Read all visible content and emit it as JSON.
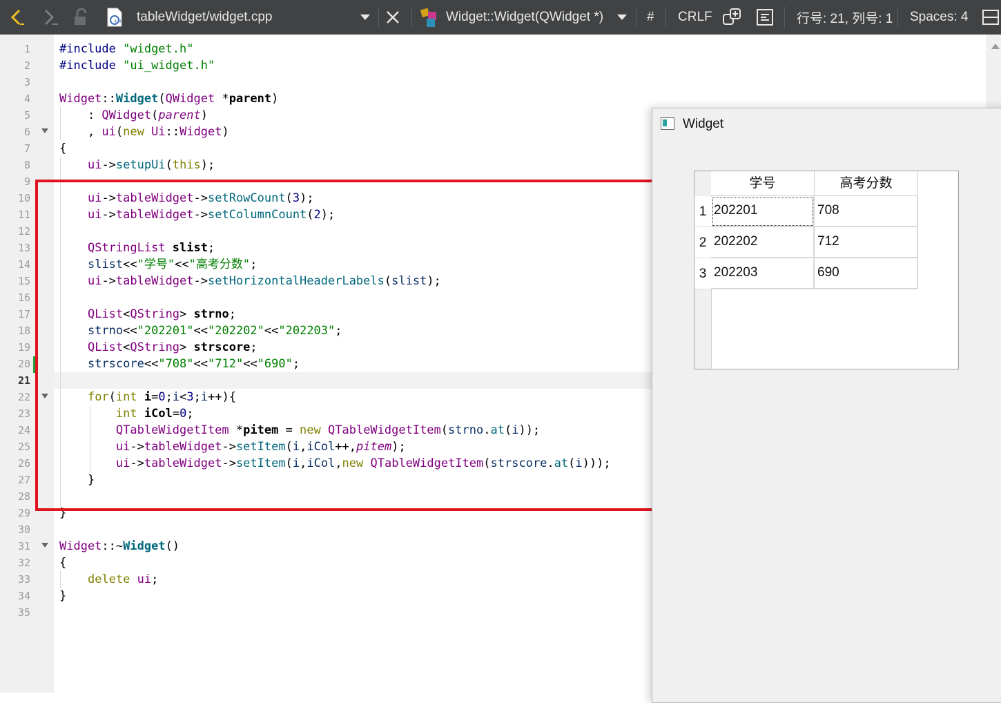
{
  "toolbar": {
    "file_name": "tableWidget/widget.cpp",
    "symbol": "Widget::Widget(QWidget *)",
    "hash": "#",
    "line_ending": "CRLF",
    "position": "行号: 21, 列号: 1",
    "indent": "Spaces: 4"
  },
  "editor": {
    "current_line": 21,
    "line_numbers": [
      "1",
      "2",
      "3",
      "4",
      "5",
      "6",
      "7",
      "8",
      "9",
      "10",
      "11",
      "12",
      "13",
      "14",
      "15",
      "16",
      "17",
      "18",
      "19",
      "20",
      "21",
      "22",
      "23",
      "24",
      "25",
      "26",
      "27",
      "28",
      "29",
      "30",
      "31",
      "32",
      "33",
      "34",
      "35"
    ],
    "lines": [
      "#include \"widget.h\"",
      "#include \"ui_widget.h\"",
      "",
      "Widget::Widget(QWidget *parent)",
      "    : QWidget(parent)",
      "    , ui(new Ui::Widget)",
      "{",
      "    ui->setupUi(this);",
      "",
      "    ui->tableWidget->setRowCount(3);",
      "    ui->tableWidget->setColumnCount(2);",
      "",
      "    QStringList slist;",
      "    slist<<\"学号\"<<\"高考分数\";",
      "    ui->tableWidget->setHorizontalHeaderLabels(slist);",
      "",
      "    QList<QString> strno;",
      "    strno<<\"202201\"<<\"202202\"<<\"202203\";",
      "    QList<QString> strscore;",
      "    strscore<<\"708\"<<\"712\"<<\"690\";",
      "",
      "    for(int i=0;i<3;i++){",
      "        int iCol=0;",
      "        QTableWidgetItem *pitem = new QTableWidgetItem(strno.at(i));",
      "        ui->tableWidget->setItem(i,iCol++,pitem);",
      "        ui->tableWidget->setItem(i,iCol,new QTableWidgetItem(strscore.at(i)));",
      "    }",
      "",
      "}",
      "",
      "Widget::~Widget()",
      "{",
      "    delete ui;",
      "}",
      ""
    ]
  },
  "widget_window": {
    "title": "Widget",
    "table": {
      "headers": [
        "学号",
        "高考分数"
      ],
      "row_headers": [
        "1",
        "2",
        "3"
      ],
      "rows": [
        [
          "202201",
          "708"
        ],
        [
          "202202",
          "712"
        ],
        [
          "202203",
          "690"
        ]
      ]
    }
  },
  "colors": {
    "toolbar_bg": "#404244",
    "highlight_box": "#e0141e",
    "keyword": "#808000",
    "type": "#800080",
    "function": "#00677c",
    "string": "#008000"
  }
}
